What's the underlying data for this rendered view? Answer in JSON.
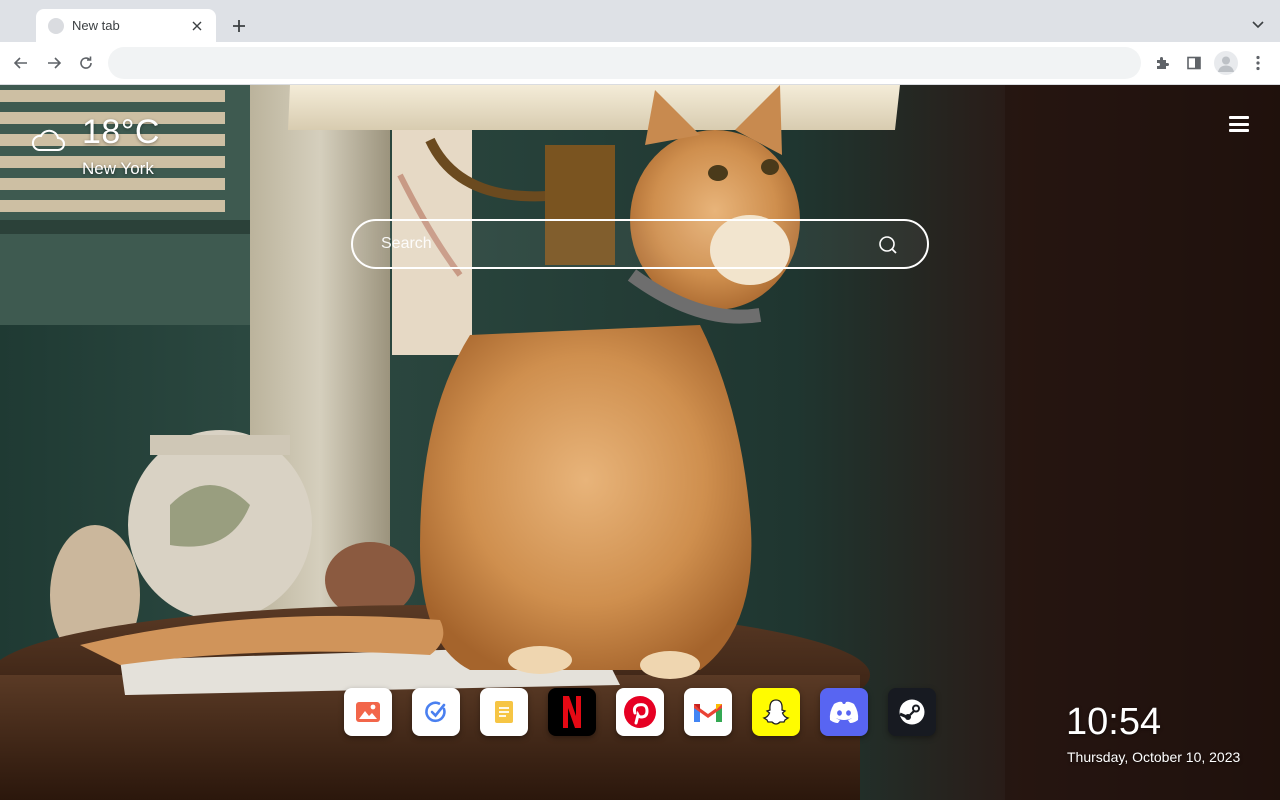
{
  "browser": {
    "tab": {
      "title": "New tab"
    },
    "omnibox": {
      "value": ""
    }
  },
  "widgets": {
    "weather": {
      "temperature": "18°C",
      "city": "New York",
      "icon": "cloud-icon"
    },
    "clock": {
      "time": "10:54",
      "date": "Thursday, October 10, 2023"
    }
  },
  "search": {
    "placeholder": "Search"
  },
  "shortcuts": [
    {
      "name": "Photos",
      "icon": "image-icon",
      "color": "#ffffff"
    },
    {
      "name": "Tasks",
      "icon": "check-icon",
      "color": "#ffffff"
    },
    {
      "name": "Notes",
      "icon": "notes-icon",
      "color": "#ffffff"
    },
    {
      "name": "Netflix",
      "icon": "netflix-icon",
      "color": "#000000"
    },
    {
      "name": "Pinterest",
      "icon": "pinterest-icon",
      "color": "#ffffff"
    },
    {
      "name": "Gmail",
      "icon": "gmail-icon",
      "color": "#ffffff"
    },
    {
      "name": "Snapchat",
      "icon": "snapchat-icon",
      "color": "#fffc00"
    },
    {
      "name": "Discord",
      "icon": "discord-icon",
      "color": "#5865f2"
    },
    {
      "name": "Steam",
      "icon": "steam-icon",
      "color": "#171a21"
    }
  ]
}
